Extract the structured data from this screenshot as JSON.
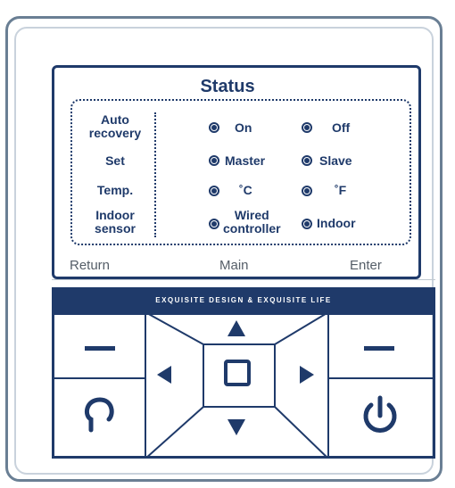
{
  "screen": {
    "title": "Status",
    "rows": [
      {
        "label_line1": "Auto",
        "label_line2": "recovery",
        "option_a": "On",
        "option_b": "Off"
      },
      {
        "label_line1": "Set",
        "label_line2": "",
        "option_a": "Master",
        "option_b": "Slave"
      },
      {
        "label_line1": "Temp.",
        "label_line2": "",
        "option_a": "˚C",
        "option_b": "˚F"
      },
      {
        "label_line1": "Indoor",
        "label_line2": "sensor",
        "option_a_line1": "Wired",
        "option_a_line2": "controller",
        "option_b": "Indoor"
      }
    ]
  },
  "softkeys": {
    "left": "Return",
    "center": "Main",
    "right": "Enter"
  },
  "slogan": "EXQUISITE DESIGN  &  EXQUISITE LIFE",
  "keypad": {
    "minus_left_icon": "minus-icon",
    "minus_right_icon": "minus-icon",
    "up_icon": "triangle-up-icon",
    "down_icon": "triangle-down-icon",
    "left_icon": "triangle-left-icon",
    "right_icon": "triangle-right-icon",
    "ok_icon": "square-icon",
    "back_icon": "return-icon",
    "power_icon": "power-icon"
  },
  "colors": {
    "accent": "#1f3a6a",
    "frame": "#6a7f94"
  }
}
